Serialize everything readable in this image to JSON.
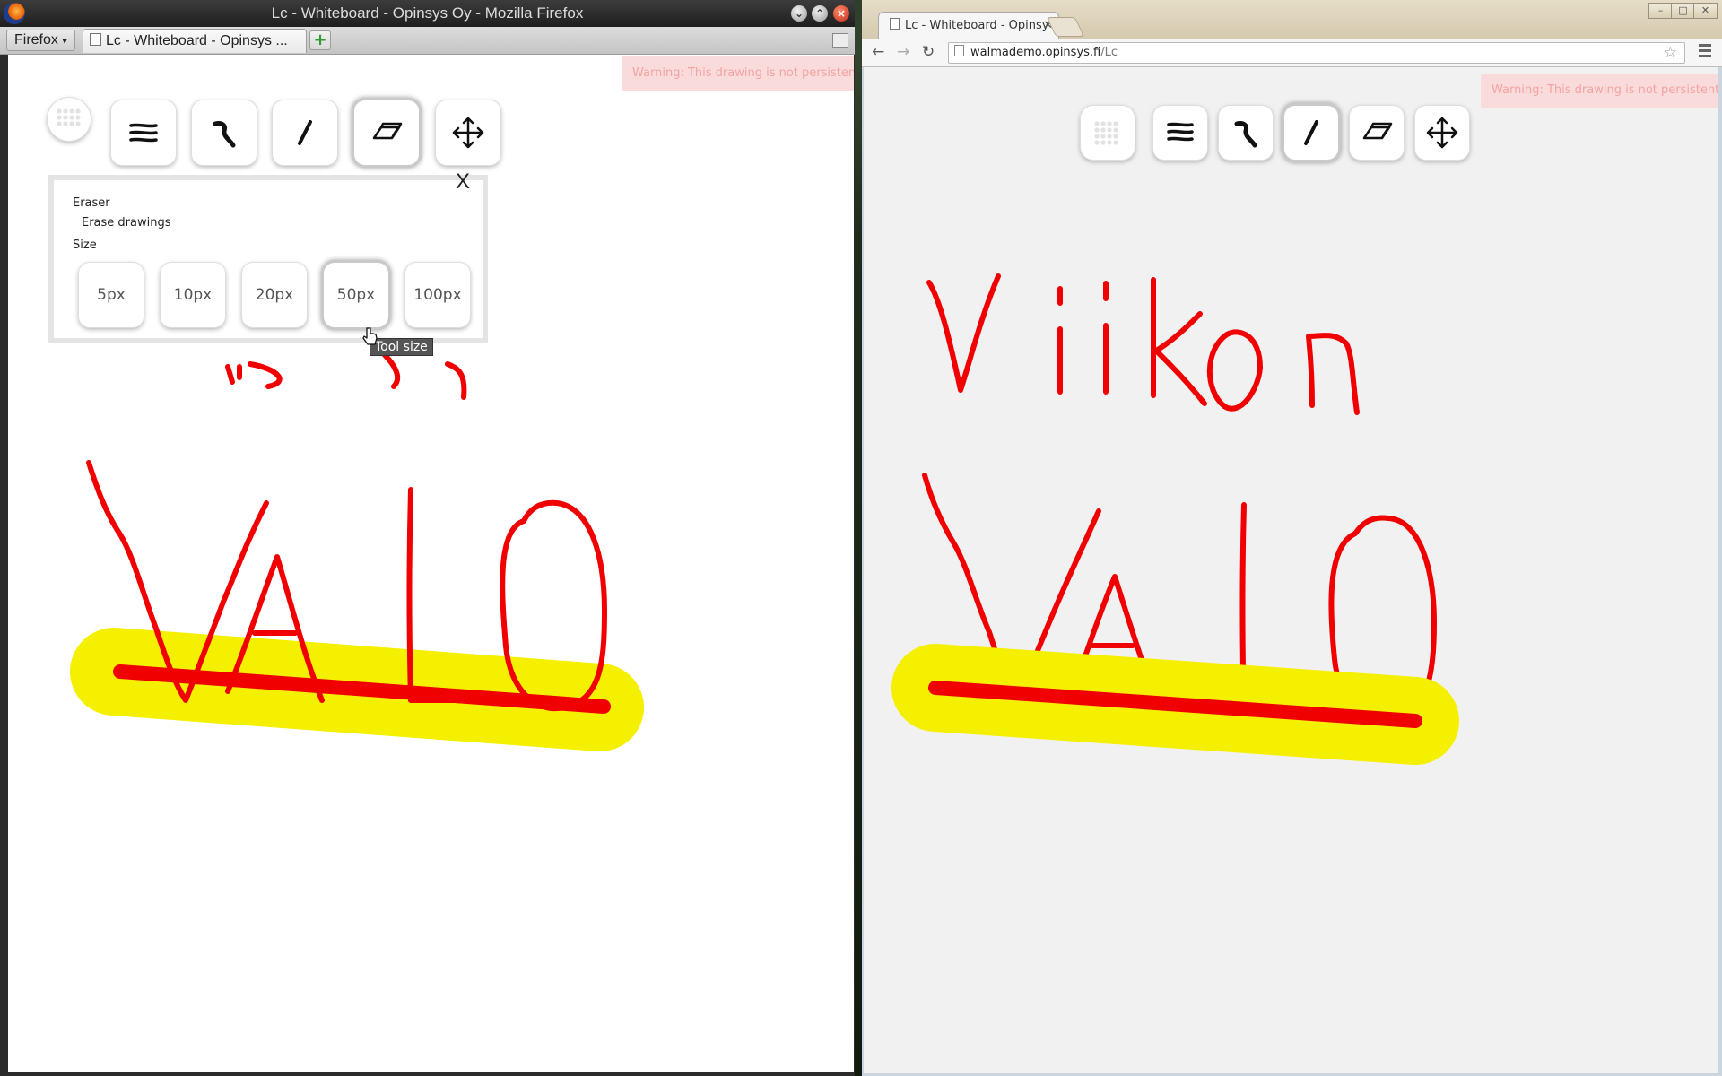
{
  "firefox": {
    "window_title": "Lc - Whiteboard - Opinsys Oy - Mozilla Firefox",
    "menu_button_label": "Firefox",
    "tab_title": "Lc - Whiteboard - Opinsys ...",
    "window_controls": {
      "minimize_icon": "chevron-down-icon",
      "maximize_icon": "chevron-up-icon",
      "close_icon": "close-icon"
    }
  },
  "chrome": {
    "tab_title": "Lc - Whiteboard - Opinsy",
    "url_host": "walmademo.opinsys.fi",
    "url_path": "/Lc"
  },
  "whiteboard": {
    "warning": "Warning: This drawing is not persistent!",
    "tools": [
      {
        "name": "colour",
        "icon": "dot-grid-icon"
      },
      {
        "name": "stroke-width",
        "icon": "lines-icon"
      },
      {
        "name": "pen",
        "icon": "pen-stroke-icon"
      },
      {
        "name": "line",
        "icon": "line-icon"
      },
      {
        "name": "eraser",
        "icon": "eraser-icon"
      },
      {
        "name": "move",
        "icon": "move-arrows-icon"
      }
    ],
    "firefox_selected_tool": "eraser",
    "chrome_selected_tool": "line",
    "eraser_panel": {
      "close_label": "X",
      "title": "Eraser",
      "description": "Erase drawings",
      "size_label": "Size",
      "sizes": [
        "5px",
        "10px",
        "20px",
        "50px",
        "100px"
      ],
      "selected_size": "50px",
      "tooltip": "Tool size"
    },
    "drawing_text": [
      "Viikon",
      "VALO"
    ],
    "colors": {
      "ink": "#f00000",
      "highlight": "#f5f000",
      "warning_bg": "#fadbdb"
    }
  }
}
